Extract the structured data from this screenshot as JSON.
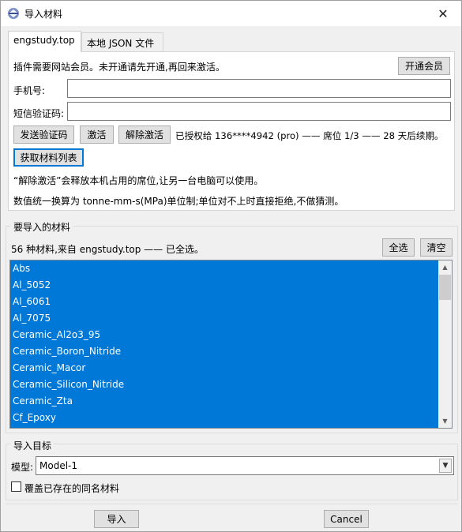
{
  "window": {
    "title": "导入材料",
    "close_glyph": "✕",
    "icon": "abaqus-app-icon"
  },
  "tabs": [
    {
      "label": "engstudy.top",
      "active": true
    },
    {
      "label": "本地 JSON 文件",
      "active": false
    }
  ],
  "site_panel": {
    "notice": "插件需要网站会员。未开通请先开通,再回来激活。",
    "open_member_button": "开通会员",
    "phone_label": "手机号:",
    "phone_value": "",
    "sms_label": "短信验证码:",
    "sms_value": "",
    "send_code_button": "发送验证码",
    "activate_button": "激活",
    "deactivate_button": "解除激活",
    "auth_status": "已授权给 136****4942 (pro) —— 席位 1/3 —— 28 天后续期。",
    "fetch_list_button": "获取材料列表",
    "info_release": "“解除激活”会释放本机占用的席位,让另一台电脑可以使用。",
    "info_units": "数值统一换算为 tonne-mm-s(MPa)单位制;单位对不上时直接拒绝,不做猜测。"
  },
  "materials_group": {
    "title": "要导入的材料",
    "summary": "56 种材料,来自 engstudy.top —— 已全选。",
    "select_all_button": "全选",
    "clear_button": "清空",
    "items": [
      "Abs",
      "Al_5052",
      "Al_6061",
      "Al_7075",
      "Ceramic_Al2o3_95",
      "Ceramic_Boron_Nitride",
      "Ceramic_Macor",
      "Ceramic_Silicon_Nitride",
      "Ceramic_Zta",
      "Cf_Epoxy"
    ],
    "selection_color": "#0078d7"
  },
  "target_group": {
    "title": "导入目标",
    "model_label": "模型:",
    "model_value": "Model-1",
    "overwrite_label": "覆盖已存在的同名材料",
    "overwrite_checked": false
  },
  "footer": {
    "import_button": "导入",
    "cancel_button": "Cancel"
  }
}
